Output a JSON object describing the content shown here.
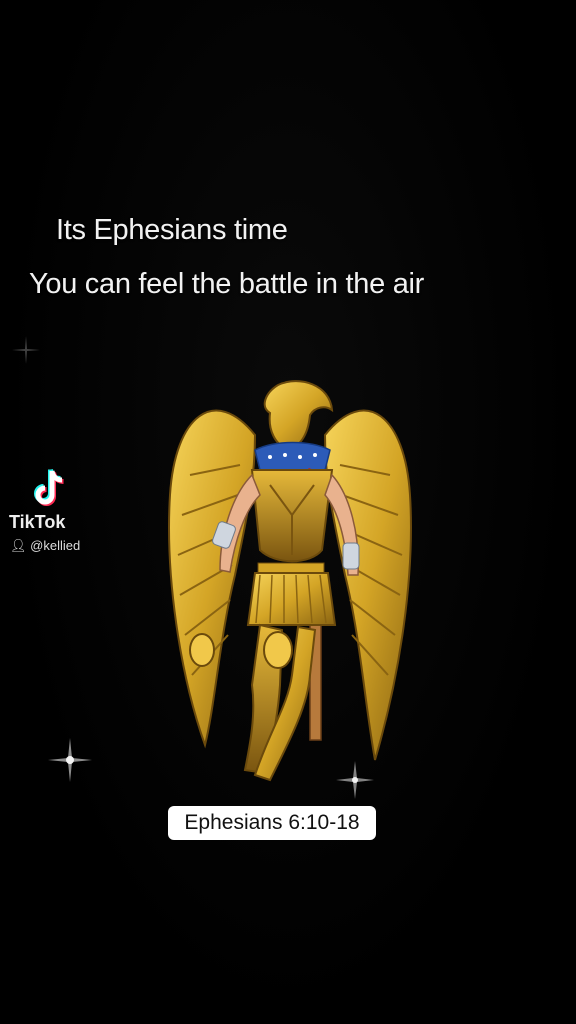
{
  "captions": {
    "line1": "Its Ephesians time",
    "line2": "You can feel the battle in the air"
  },
  "watermark": {
    "brand": "TikTok",
    "handle": "@kellied",
    "icon": "tiktok-logo-icon"
  },
  "reference": {
    "label": "Ephesians 6:10-18"
  },
  "colors": {
    "background": "#000000",
    "gold": "#d4a526",
    "badge_bg": "#ffffff"
  }
}
